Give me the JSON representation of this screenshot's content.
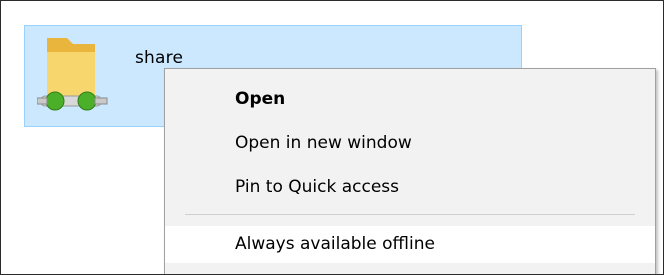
{
  "folder": {
    "name": "share",
    "icon": "network-shared-folder-icon",
    "selected": true
  },
  "context_menu": {
    "items": [
      {
        "label": "Open",
        "bold": true
      },
      {
        "label": "Open in new window",
        "bold": false
      },
      {
        "label": "Pin to Quick access",
        "bold": false
      },
      {
        "label": "Always available offline",
        "bold": false,
        "hover": true
      }
    ]
  },
  "colors": {
    "selection_background": "#cce8ff",
    "selection_border": "#99d1ff",
    "menu_background": "#f2f2f2",
    "menu_hover": "#ffffff",
    "folder_yellow": "#f7d66e",
    "network_green": "#4caf2a"
  }
}
